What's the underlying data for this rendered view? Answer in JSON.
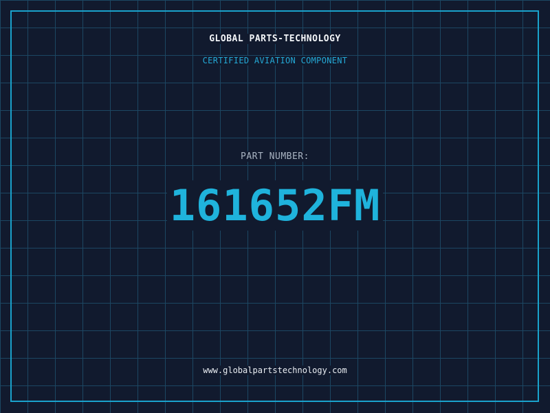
{
  "company": "GLOBAL PARTS-TECHNOLOGY",
  "tagline": "CERTIFIED AVIATION COMPONENT",
  "part_number_label": "PART NUMBER:",
  "part_number": "161652FM",
  "website": "www.globalpartstechnology.com",
  "colors": {
    "background": "#111a2e",
    "grid": "#1c4763",
    "border": "#1aa3cc",
    "accent": "#1fb3dc",
    "label": "#a9b4c2",
    "text": "#f2f5f8"
  }
}
